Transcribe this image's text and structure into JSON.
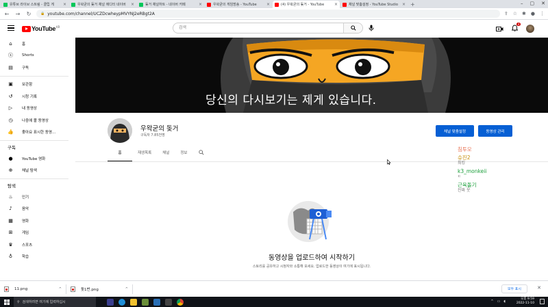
{
  "browser": {
    "tabs": [
      {
        "title": "유튜브 라이브 스트림 - 클립 게",
        "favicon": "green",
        "active": false
      },
      {
        "title": "우왁굳의 돚거 채널 에디터 네이버",
        "favicon": "green",
        "active": false
      },
      {
        "title": "돚거 채널하트 - 네이버 카페",
        "favicon": "green",
        "active": false
      },
      {
        "title": "우왁굳의 게임방송 - YouTube",
        "favicon": "red",
        "active": false
      },
      {
        "title": "(4) 우왁굳의 돚거 - YouTube",
        "favicon": "red",
        "active": true
      },
      {
        "title": "채널 맞춤설정 - YouTube Studio",
        "favicon": "red",
        "active": false
      }
    ],
    "new_tab": "+",
    "url": "youtube.com/channel/UCZDcwheypMVYNJ2eRBgt2A"
  },
  "masthead": {
    "logo_text": "YouTube",
    "logo_region": "KR",
    "search_placeholder": "검색",
    "notification_count": "4"
  },
  "sidebar": {
    "main": [
      {
        "label": "홈",
        "icon": "home-icon"
      },
      {
        "label": "Shorts",
        "icon": "shorts-icon"
      },
      {
        "label": "구독",
        "icon": "subscriptions-icon"
      }
    ],
    "library": [
      {
        "label": "보관함",
        "icon": "library-icon"
      },
      {
        "label": "시청 기록",
        "icon": "history-icon"
      },
      {
        "label": "내 동영상",
        "icon": "my-videos-icon"
      },
      {
        "label": "나중에 볼 동영상",
        "icon": "watch-later-icon"
      },
      {
        "label": "좋아요 표시한 동영...",
        "icon": "like-icon"
      }
    ],
    "subscriptions_title": "구독",
    "subscriptions": [
      {
        "label": "YouTube 영화",
        "icon": "youtube-movies-icon"
      },
      {
        "label": "채널 탐색",
        "icon": "browse-channels-icon"
      }
    ],
    "explore_title": "탐색",
    "explore": [
      {
        "label": "인기",
        "icon": "trending-icon"
      },
      {
        "label": "음악",
        "icon": "music-icon"
      },
      {
        "label": "영화",
        "icon": "movies-icon"
      },
      {
        "label": "게임",
        "icon": "gaming-icon"
      },
      {
        "label": "스포츠",
        "icon": "sports-icon"
      },
      {
        "label": "학습",
        "icon": "learning-icon"
      }
    ]
  },
  "banner": {
    "caption": "당신의 다시보기는 제게 있습니다."
  },
  "channel": {
    "name": "우왁굳의 돚거",
    "subscribers": "구독자 7.85천명",
    "customize_button": "채널 맞춤설정",
    "manage_button": "동영상 관리",
    "tabs": [
      "홈",
      "재생목록",
      "채널",
      "정보"
    ]
  },
  "empty_state": {
    "title": "동영상을 업로드하여 시작하기",
    "description": "스토리를 공유하고 시청자와 소통해 보세요. 업로드한 동영상이 여기에 표시됩니다."
  },
  "overlay": [
    {
      "name": "침투모",
      "message": "",
      "color": "#e8775a"
    },
    {
      "name": "슈진2",
      "message": "최킹",
      "color": "#c58a00"
    },
    {
      "name": "k3_monkeii",
      "message": "ㄷ",
      "color": "#1a9e3a"
    },
    {
      "name": "근육돌기",
      "message": "진짜 웃",
      "color": "#1a9e3a"
    }
  ],
  "downloads": [
    {
      "filename": "11.png"
    },
    {
      "filename": "돚1번.png"
    }
  ],
  "downloads_show_all": "모두 표시",
  "taskbar": {
    "search_placeholder": "검색하려면 여기에 입력하십시",
    "time": "오후 9:59",
    "date": "2022-11-10"
  },
  "colors": {
    "accent_blue": "#065fd4",
    "youtube_red": "#ff0000"
  }
}
